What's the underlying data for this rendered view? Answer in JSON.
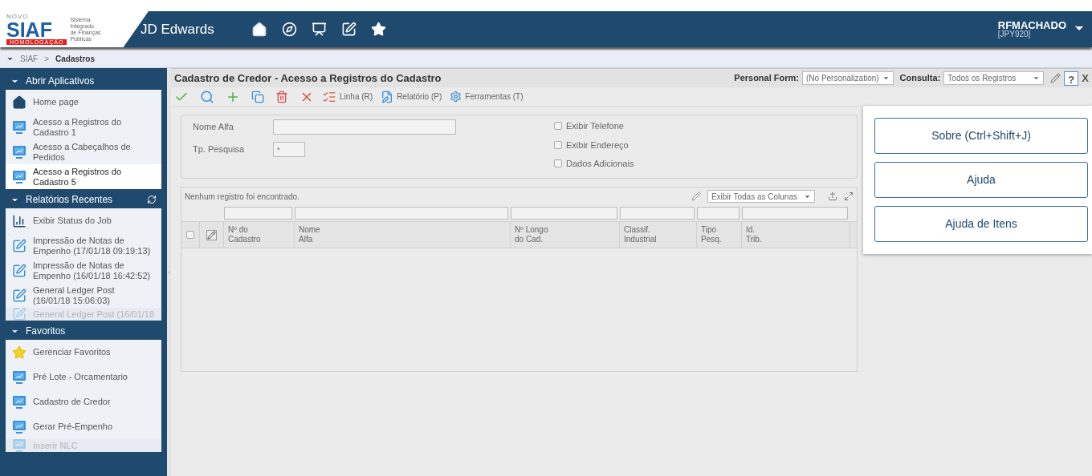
{
  "header": {
    "logo": {
      "top": "NOVO",
      "main": "SIAF",
      "sub": [
        "Sistema",
        "Integrado",
        "de Finanças",
        "Públicas"
      ],
      "badge": "HOMOLOGAÇÃO"
    },
    "product": "JD Edwards",
    "user": "RFMACHADO",
    "environment": "[JPY920]"
  },
  "breadcrumb": {
    "root": "SIAF",
    "separator": ">",
    "current": "Cadastros"
  },
  "sidebar": [
    {
      "title": "Abrir Aplicativos",
      "refresh": false,
      "items": [
        {
          "kind": "home",
          "label": "Home page",
          "selected": false,
          "faded": false
        },
        {
          "kind": "app",
          "label": "Acesso a Registros do Cadastro 1",
          "selected": false,
          "faded": false
        },
        {
          "kind": "app",
          "label": "Acesso a Cabeçalhos de Pedidos",
          "selected": false,
          "faded": false
        },
        {
          "kind": "app",
          "label": "Acesso a Registros do Cadastro 5",
          "selected": true,
          "faded": false
        }
      ]
    },
    {
      "title": "Relatórios Recentes",
      "refresh": true,
      "items": [
        {
          "kind": "job",
          "label": "Exibir Status do Job",
          "selected": false,
          "faded": false
        },
        {
          "kind": "report",
          "label": "Impressão de Notas de Empenho (17/01/18 09:19:13)",
          "selected": false,
          "faded": false
        },
        {
          "kind": "report",
          "label": "Impressão de Notas de Empenho (16/01/18 16:42:52)",
          "selected": false,
          "faded": false
        },
        {
          "kind": "report",
          "label": "General Ledger Post (16/01/18 15:06:03)",
          "selected": false,
          "faded": false
        },
        {
          "kind": "report",
          "label": "General Ledger Post (16/01/18",
          "selected": false,
          "faded": true
        }
      ]
    },
    {
      "title": "Favoritos",
      "refresh": false,
      "items": [
        {
          "kind": "favorites",
          "label": "Gerenciar Favoritos",
          "selected": false,
          "faded": false
        },
        {
          "kind": "app",
          "label": "Pré Lote - Orcamentario",
          "selected": false,
          "faded": false
        },
        {
          "kind": "app",
          "label": "Cadastro de Credor",
          "selected": false,
          "faded": false
        },
        {
          "kind": "app",
          "label": "Gerar Pré-Empenho",
          "selected": false,
          "faded": false
        },
        {
          "kind": "app",
          "label": "Inserir NLC",
          "selected": false,
          "faded": true
        }
      ]
    }
  ],
  "form": {
    "title": "Cadastro de Credor - Acesso a Registros do Cadastro",
    "personal_form": {
      "label": "Personal Form:",
      "value": "(No Personalization)"
    },
    "consulta": {
      "label": "Consulta:",
      "value": "Todos os Registros"
    },
    "help": {
      "label": "?",
      "selected": true
    },
    "close": "X",
    "toolbar": [
      {
        "kind": "ok"
      },
      {
        "kind": "find"
      },
      {
        "kind": "add"
      },
      {
        "kind": "copy"
      },
      {
        "kind": "delete"
      },
      {
        "kind": "cancel"
      },
      {
        "kind": "row",
        "label": "Linha (R)"
      },
      {
        "kind": "report",
        "label": "Relatório (P)"
      },
      {
        "kind": "tools",
        "label": "Ferramentas (T)"
      }
    ],
    "fields": [
      {
        "label": "Nome Alfa"
      },
      {
        "label": "Tp. Pesquisa",
        "value": "*"
      }
    ],
    "options": [
      {
        "label": "Exibir Telefone",
        "checked": false
      },
      {
        "label": "Exibir Endereço",
        "checked": false
      },
      {
        "label": "Dados Adicionais",
        "checked": false
      }
    ],
    "grid": {
      "message": "Nenhum registro foi encontrado.",
      "columns_select": "Exibir Todas as Colunas",
      "select_all": false,
      "columns": [
        {
          "lines": [
            "Nº do",
            "Cadastro"
          ]
        },
        {
          "lines": [
            "Nome",
            "Alfa"
          ]
        },
        {
          "lines": [
            "Nº Longo",
            "do Cad."
          ]
        },
        {
          "lines": [
            "Classif.",
            "Industrial"
          ]
        },
        {
          "lines": [
            "Tipo",
            "Pesq."
          ]
        },
        {
          "lines": [
            "Id.",
            "Trib."
          ]
        }
      ]
    }
  },
  "help_menu": [
    "Sobre (Ctrl+Shift+J)",
    "Ajuda",
    "Ajuda de Itens"
  ]
}
